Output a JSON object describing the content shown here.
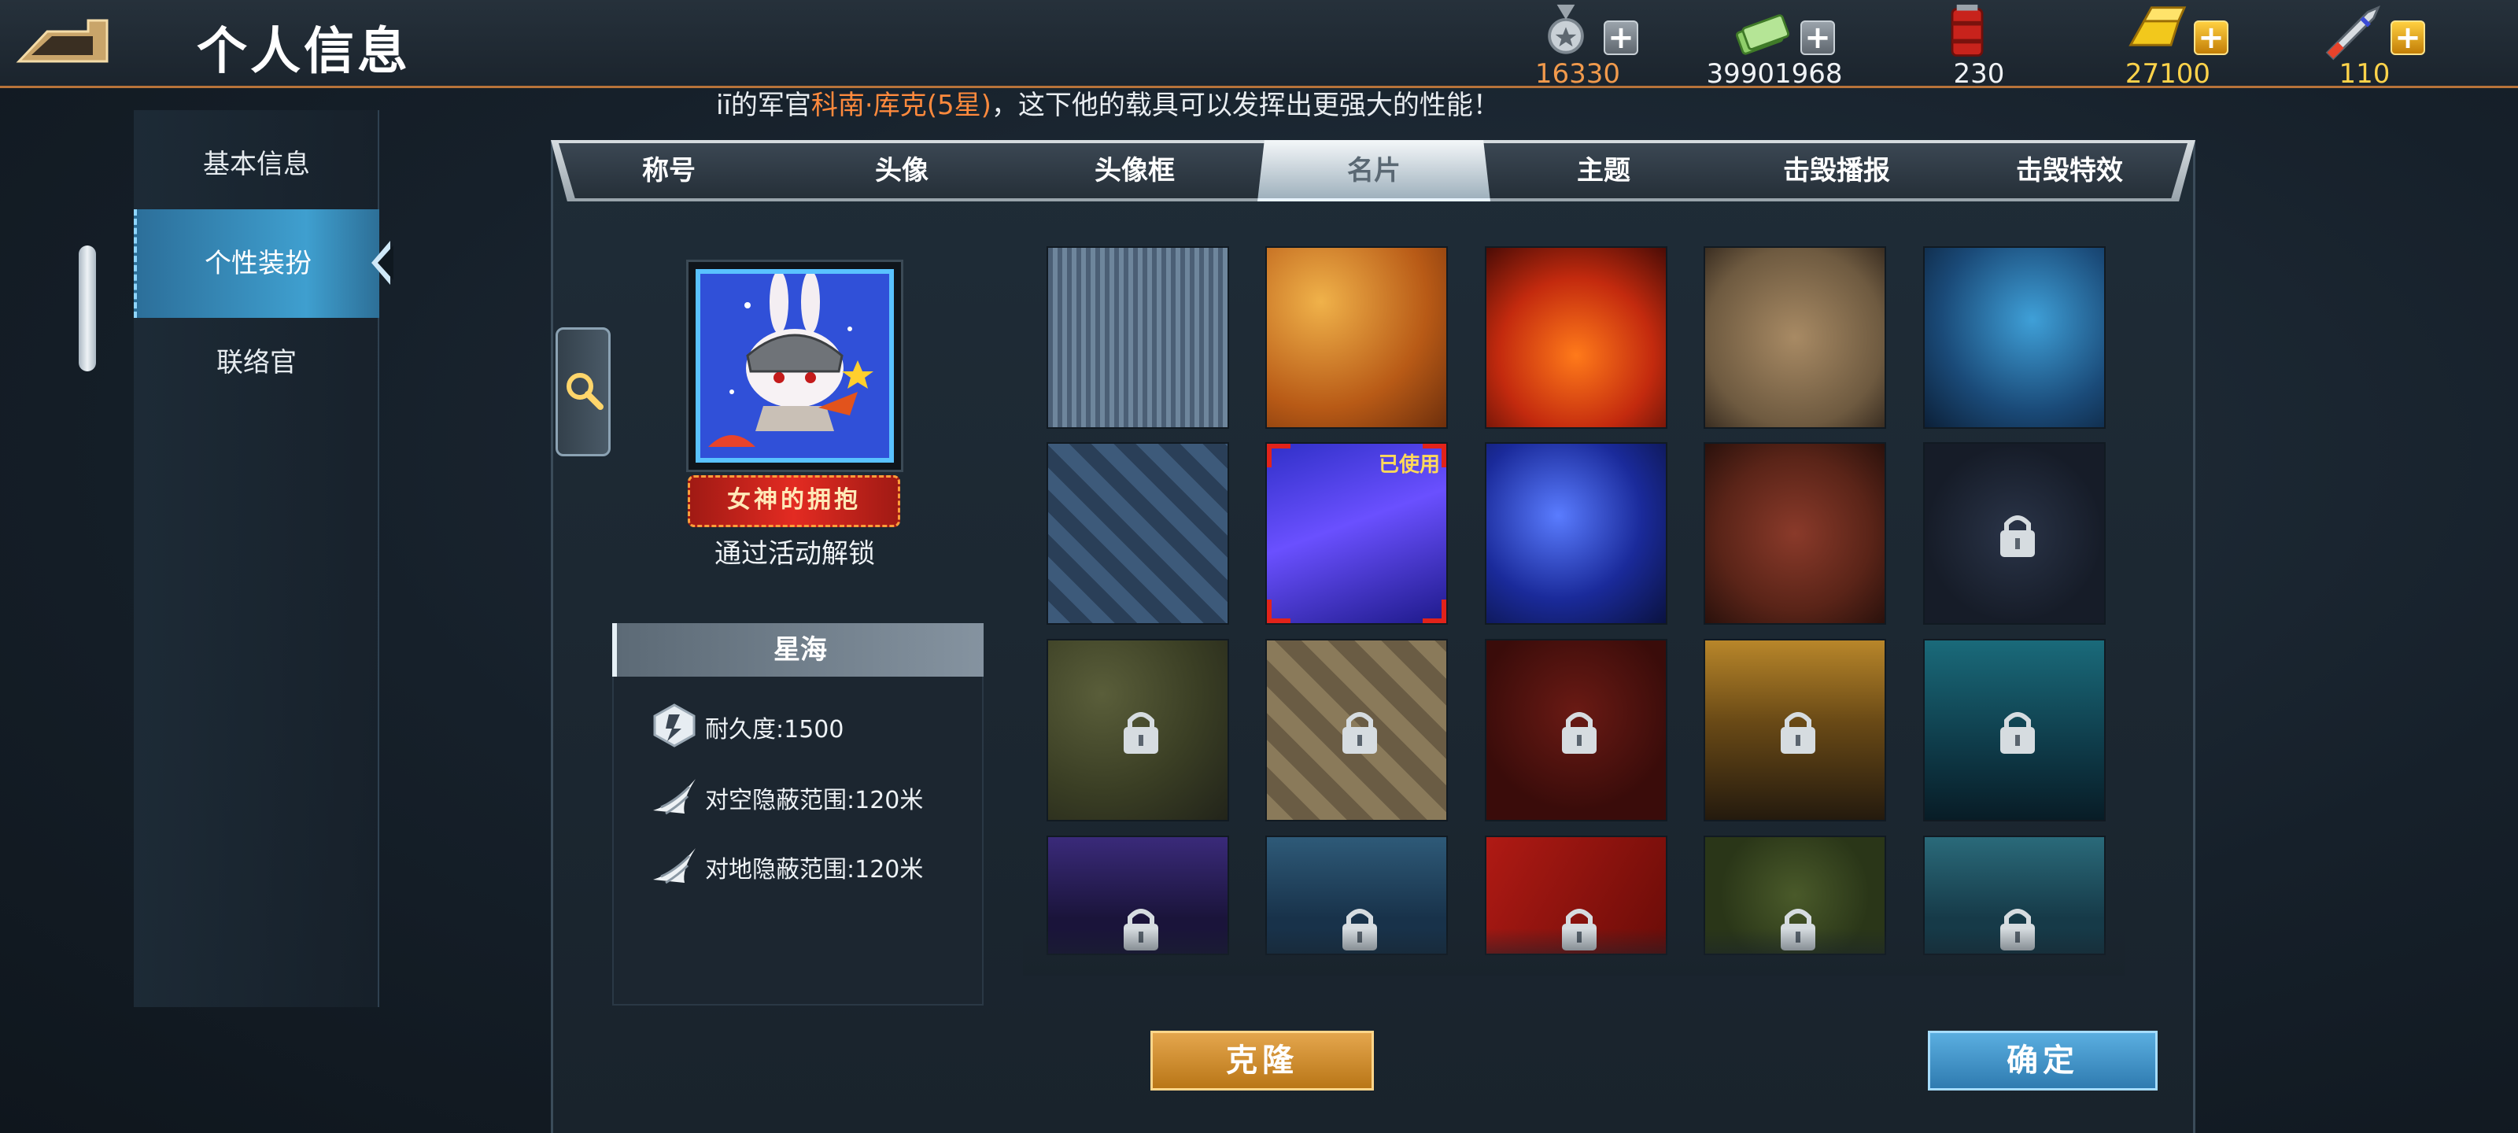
{
  "header": {
    "title": "个人信息",
    "resources": [
      {
        "name": "medal",
        "icon": "medal-icon",
        "value": "16330",
        "plus": "+",
        "plus_style": "grey",
        "value_color": "#f19a4c"
      },
      {
        "name": "cash",
        "icon": "cash-icon",
        "value": "39901968",
        "plus": "+",
        "plus_style": "grey",
        "value_color": "#f0f3f6"
      },
      {
        "name": "oil",
        "icon": "oil-barrel-icon",
        "value": "230",
        "plus": "",
        "plus_style": "none",
        "value_color": "#f0f3f6"
      },
      {
        "name": "gold",
        "icon": "gold-bar-icon",
        "value": "27100",
        "plus": "+",
        "plus_style": "gold",
        "value_color": "#ffd34a"
      },
      {
        "name": "rocket",
        "icon": "rocket-icon",
        "value": "110",
        "plus": "+",
        "plus_style": "gold",
        "value_color": "#ffd34a"
      }
    ]
  },
  "marquee": {
    "prefix": "iī的军官",
    "highlight": "科南·库克(5星)",
    "suffix": "，这下他的载具可以发挥出更强大的性能！"
  },
  "sidebar": {
    "items": [
      {
        "label": "基本信息",
        "active": false
      },
      {
        "label": "个性装扮",
        "active": true
      },
      {
        "label": "联络官",
        "active": false
      }
    ]
  },
  "tabs": [
    {
      "label": "称号",
      "active": false
    },
    {
      "label": "头像",
      "active": false
    },
    {
      "label": "头像框",
      "active": false
    },
    {
      "label": "名片",
      "active": true
    },
    {
      "label": "主题",
      "active": false
    },
    {
      "label": "击毁播报",
      "active": false
    },
    {
      "label": "击毁特效",
      "active": false
    }
  ],
  "preview": {
    "badge_text": "女神的拥抱",
    "unlock_hint": "通过活动解锁"
  },
  "info": {
    "name": "星海",
    "stats": [
      {
        "icon": "durability-icon",
        "text": "耐久度:1500"
      },
      {
        "icon": "stealth-air-icon",
        "text": "对空隐蔽范围:120米"
      },
      {
        "icon": "stealth-ground-icon",
        "text": "对地隐蔽范围:120米"
      }
    ]
  },
  "grid": {
    "used_label": "已使用",
    "tiles": [
      {
        "theme": "hex-pattern",
        "locked": false,
        "selected": false
      },
      {
        "theme": "autumn-leaves",
        "locked": false,
        "selected": false
      },
      {
        "theme": "flames",
        "locked": false,
        "selected": false
      },
      {
        "theme": "desert-star",
        "locked": false,
        "selected": false
      },
      {
        "theme": "blue-hexagons",
        "locked": false,
        "selected": false
      },
      {
        "theme": "checkered-blue",
        "locked": false,
        "selected": false
      },
      {
        "theme": "star-sea",
        "locked": false,
        "selected": true
      },
      {
        "theme": "galaxy",
        "locked": false,
        "selected": false
      },
      {
        "theme": "hammer-sickle",
        "locked": false,
        "selected": false
      },
      {
        "theme": "dark-star",
        "locked": true,
        "selected": false
      },
      {
        "theme": "green-camo",
        "locked": true,
        "selected": false
      },
      {
        "theme": "beige-diamonds",
        "locked": true,
        "selected": false
      },
      {
        "theme": "dark-red",
        "locked": true,
        "selected": false
      },
      {
        "theme": "sunset",
        "locked": true,
        "selected": false
      },
      {
        "theme": "teal-sea",
        "locked": true,
        "selected": false
      },
      {
        "theme": "purple-night",
        "locked": true,
        "selected": false
      },
      {
        "theme": "helicopter-silhouette",
        "locked": true,
        "selected": false
      },
      {
        "theme": "china-flag",
        "locked": true,
        "selected": false
      },
      {
        "theme": "green-ornament",
        "locked": true,
        "selected": false
      },
      {
        "theme": "teal-snowflake",
        "locked": true,
        "selected": false
      }
    ]
  },
  "buttons": {
    "clone": "克隆",
    "confirm": "确定"
  }
}
